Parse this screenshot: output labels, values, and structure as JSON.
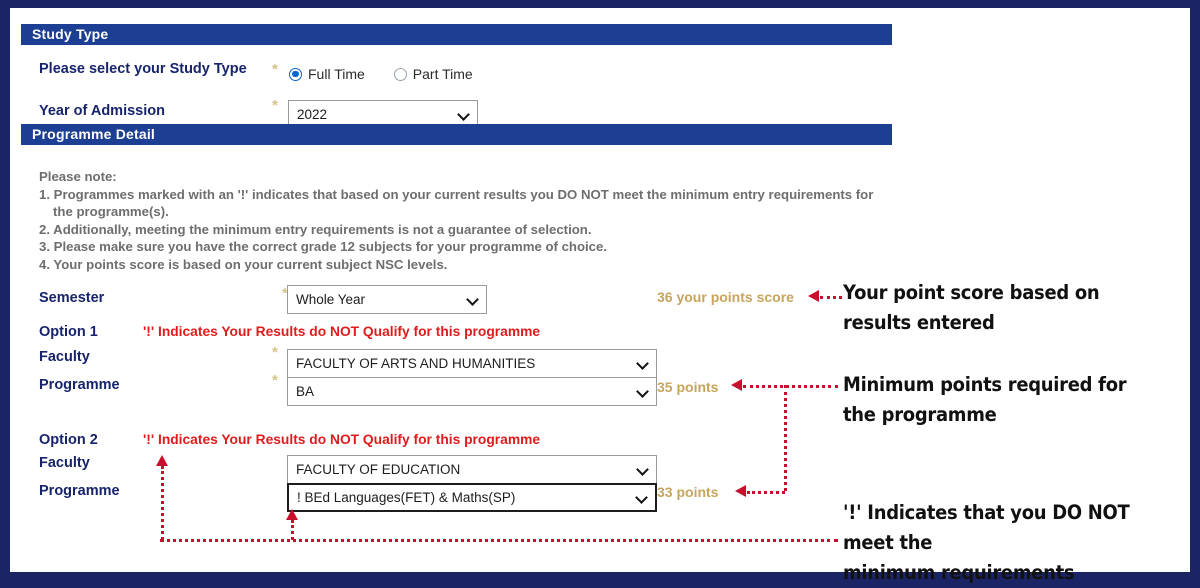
{
  "sections": {
    "study_type": "Study Type",
    "programme_detail": "Programme Detail"
  },
  "study_type": {
    "question_label": "Please select your Study Type",
    "required_mark": "*",
    "options": [
      {
        "label": "Full Time",
        "selected": true
      },
      {
        "label": "Part Time",
        "selected": false
      }
    ],
    "year_label": "Year of Admission",
    "year_value": "2022"
  },
  "note": {
    "heading": "Please note:",
    "items": [
      "1. Programmes marked with an '!' indicates that based on your current results you DO NOT meet the minimum entry requirements for the programme(s).",
      "2. Additionally, meeting the minimum entry requirements is not a guarantee of selection.",
      "3. Please make sure you have the correct grade 12 subjects for your programme of choice.",
      "4. Your points score is based on your current subject NSC levels."
    ]
  },
  "form": {
    "semester_label": "Semester",
    "semester_value": "Whole Year",
    "faculty_label": "Faculty",
    "programme_label": "Programme",
    "option1_label": "Option 1",
    "option2_label": "Option 2",
    "qualify_warning": "'!' Indicates Your Results do NOT Qualify for this programme",
    "option1": {
      "faculty_value": "FACULTY OF ARTS AND HUMANITIES",
      "programme_value": "BA"
    },
    "option2": {
      "faculty_value": "FACULTY OF EDUCATION",
      "programme_value": "! BEd Languages(FET) & Maths(SP)"
    }
  },
  "points": {
    "your_score": "36 your points score",
    "option1_points": "35 points",
    "option2_points": "33 points"
  },
  "annotations": {
    "score": "Your point score based on\nresults entered",
    "score_line1": "Your point score based on",
    "score_line2": "results entered",
    "minimum_line1": "Minimum points required for",
    "minimum_line2": "the programme",
    "exclam_line1": "'!' Indicates that you DO NOT meet the",
    "exclam_line2": "minimum requirements"
  },
  "colors": {
    "frame": "#1b2566",
    "section_bar": "#1c3f94",
    "label": "#17246b",
    "warning_red": "#e01b1b",
    "annotation_red": "#c8102e",
    "points_tan": "#c8a45c",
    "required_tan": "#d6c38c",
    "radio_blue": "#0a63cf",
    "note_gray": "#6d6e70"
  }
}
